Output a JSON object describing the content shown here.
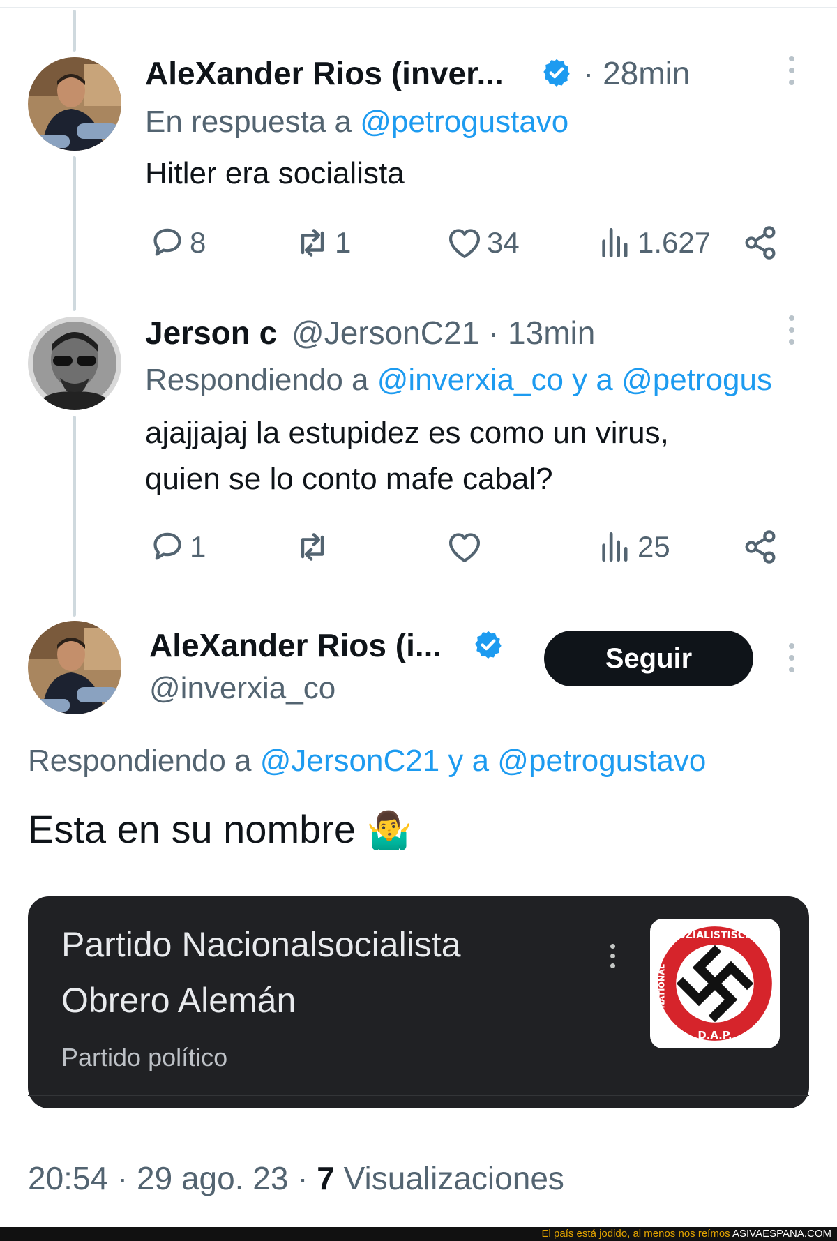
{
  "tweets": [
    {
      "display_name": "AleXander Rios (inver...",
      "time": "· 28min",
      "reply_prefix": "En respuesta a",
      "reply_handle": "@petrogustavo",
      "text": "Hitler era socialista",
      "actions": {
        "replies": "8",
        "retweets": "1",
        "likes": "34",
        "views": "1.627"
      }
    },
    {
      "display_name": "Jerson c",
      "handle_time": "@JersonC21 · 13min",
      "reply_prefix": "Respondiendo a",
      "reply_handles": "@inverxia_co y a @petrogus",
      "text_line1": "ajajjajaj la estupidez es como un virus,",
      "text_line2": "quien se lo conto mafe cabal?",
      "actions": {
        "replies": "1",
        "retweets": "",
        "likes": "",
        "views": "25"
      }
    }
  ],
  "main_tweet": {
    "display_name": "AleXander Rios (i...",
    "handle": "@inverxia_co",
    "follow_label": "Seguir",
    "reply_prefix": "Respondiendo a",
    "reply_handles": "@JersonC21 y a @petrogustavo",
    "text": "Esta en su nombre",
    "emoji": "🤷‍♂️",
    "card": {
      "title_line1": "Partido Nacionalsocialista",
      "title_line2": "Obrero Alemán",
      "subtitle": "Partido político",
      "logo_text": "NATIONAL-SOZIALISTISCHE D.A.P."
    },
    "timestamp": "20:54 · 29 ago. 23 ·",
    "views_count": "7",
    "views_label": "Visualizaciones"
  },
  "footer": {
    "tagline": "El país está jodido, al menos nos reímos",
    "brand": "ASIVAESPANA.COM"
  },
  "colors": {
    "accent": "#1d9bf0",
    "text": "#0f1419",
    "secondary": "#536471",
    "card_bg": "#202124",
    "footer_tagline": "#e3a400"
  }
}
